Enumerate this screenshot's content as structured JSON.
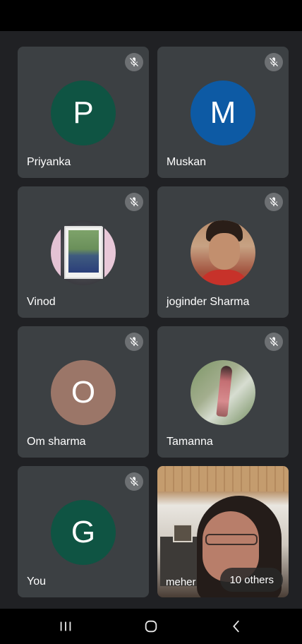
{
  "colors": {
    "background": "#202124",
    "tile": "#3c4043",
    "mute_badge": "#6d7073"
  },
  "participants": [
    {
      "name": "Priyanka",
      "initial": "P",
      "avatar_color": "#0f5443",
      "muted": true
    },
    {
      "name": "Muskan",
      "initial": "M",
      "avatar_color": "#0d5aa4",
      "muted": true
    },
    {
      "name": "Vinod",
      "initial": "",
      "photo": true,
      "muted": true
    },
    {
      "name": "joginder Sharma",
      "initial": "",
      "photo": true,
      "muted": true
    },
    {
      "name": "Om sharma",
      "initial": "O",
      "avatar_color": "#9b7668",
      "muted": true
    },
    {
      "name": "Tamanna",
      "initial": "",
      "photo": true,
      "muted": true
    },
    {
      "name": "You",
      "initial": "G",
      "avatar_color": "#0f5443",
      "muted": true
    }
  ],
  "video_tile": {
    "name": "meher",
    "others_label": "10 others"
  },
  "icons": {
    "mute": "mic-off-icon",
    "recents": "recent-apps-icon",
    "home": "home-icon",
    "back": "back-icon"
  }
}
